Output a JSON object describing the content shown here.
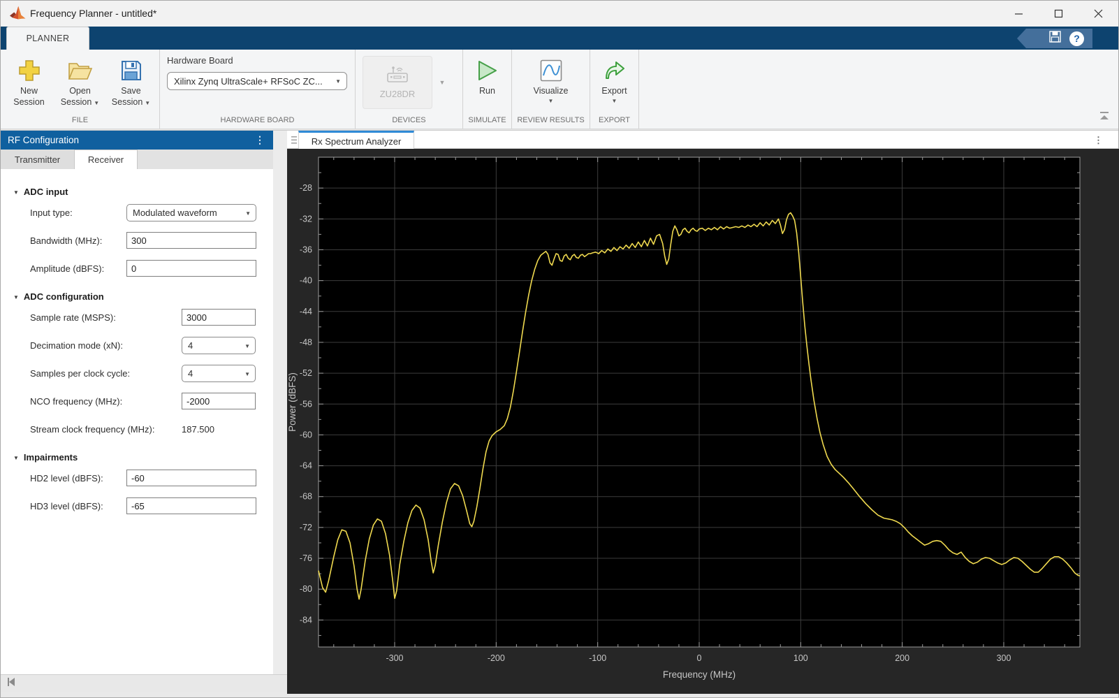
{
  "window": {
    "title": "Frequency Planner - untitled*"
  },
  "ribbon": {
    "tab_label": "PLANNER",
    "file": {
      "section_label": "FILE",
      "new_label": "New Session",
      "open_label": "Open Session",
      "save_label": "Save Session"
    },
    "hardware_board": {
      "section_label": "HARDWARE BOARD",
      "field_label": "Hardware Board",
      "value": "Xilinx Zynq UltraScale+ RFSoC ZC..."
    },
    "devices": {
      "section_label": "DEVICES",
      "device_label": "ZU28DR"
    },
    "simulate": {
      "section_label": "SIMULATE",
      "run_label": "Run"
    },
    "review": {
      "section_label": "REVIEW RESULTS",
      "visualize_label": "Visualize"
    },
    "export": {
      "section_label": "EXPORT",
      "export_label": "Export"
    }
  },
  "left_panel": {
    "header_title": "RF Configuration",
    "tabs": [
      {
        "label": "Transmitter"
      },
      {
        "label": "Receiver"
      }
    ],
    "adc_input": {
      "title": "ADC input",
      "input_type_label": "Input type:",
      "input_type_value": "Modulated waveform",
      "bandwidth_label": "Bandwidth (MHz):",
      "bandwidth_value": "300",
      "amplitude_label": "Amplitude (dBFS):",
      "amplitude_value": "0"
    },
    "adc_config": {
      "title": "ADC configuration",
      "sample_rate_label": "Sample rate (MSPS):",
      "sample_rate_value": "3000",
      "decimation_label": "Decimation mode (xN):",
      "decimation_value": "4",
      "spcc_label": "Samples per clock cycle:",
      "spcc_value": "4",
      "nco_label": "NCO frequency (MHz):",
      "nco_value": "-2000",
      "stream_clock_label": "Stream clock frequency (MHz):",
      "stream_clock_value": "187.500"
    },
    "impairments": {
      "title": "Impairments",
      "hd2_label": "HD2 level (dBFS):",
      "hd2_value": "-60",
      "hd3_label": "HD3 level (dBFS):",
      "hd3_value": "-65"
    }
  },
  "doc": {
    "tab_label": "Rx Spectrum Analyzer"
  },
  "chart_data": {
    "type": "line",
    "title": "Rx Spectrum Analyzer",
    "xlabel": "Frequency (MHz)",
    "ylabel": "Power (dBFS)",
    "xlim": [
      -375,
      375
    ],
    "ylim": [
      -87.5,
      -24
    ],
    "xticks": [
      -300,
      -200,
      -100,
      0,
      100,
      200,
      300
    ],
    "yticks": [
      -84,
      -80,
      -76,
      -72,
      -68,
      -64,
      -60,
      -56,
      -52,
      -48,
      -44,
      -40,
      -36,
      -32,
      -28
    ],
    "x_minor_step": 20,
    "y_minor_step": 2,
    "grid": true,
    "legend": "none",
    "colors": {
      "trace": "#EFD94F",
      "plot_bg": "#000000",
      "outer_bg": "#262626",
      "grid": "#3c3c3c",
      "axis": "#9c9c9c",
      "tick_text": "#c6c6c6"
    },
    "series": [
      {
        "name": "Rx spectrum",
        "points": [
          [
            -375,
            -77.6
          ],
          [
            -371,
            -79.8
          ],
          [
            -368,
            -80.4
          ],
          [
            -365,
            -78.9
          ],
          [
            -360,
            -75.8
          ],
          [
            -356,
            -73.6
          ],
          [
            -352,
            -72.3
          ],
          [
            -348,
            -72.5
          ],
          [
            -344,
            -74.0
          ],
          [
            -340,
            -77.0
          ],
          [
            -337,
            -80.0
          ],
          [
            -335,
            -81.3
          ],
          [
            -333,
            -80.0
          ],
          [
            -329,
            -76.3
          ],
          [
            -325,
            -73.5
          ],
          [
            -321,
            -71.7
          ],
          [
            -317,
            -70.9
          ],
          [
            -313,
            -71.2
          ],
          [
            -309,
            -72.8
          ],
          [
            -305,
            -75.6
          ],
          [
            -302,
            -78.8
          ],
          [
            -300,
            -81.2
          ],
          [
            -298,
            -80.2
          ],
          [
            -295,
            -76.8
          ],
          [
            -291,
            -73.8
          ],
          [
            -287,
            -71.4
          ],
          [
            -283,
            -69.8
          ],
          [
            -279,
            -69.1
          ],
          [
            -275,
            -69.5
          ],
          [
            -271,
            -71.0
          ],
          [
            -267,
            -73.6
          ],
          [
            -264,
            -76.4
          ],
          [
            -262,
            -77.9
          ],
          [
            -260,
            -76.9
          ],
          [
            -257,
            -74.3
          ],
          [
            -253,
            -71.3
          ],
          [
            -249,
            -68.8
          ],
          [
            -245,
            -67.0
          ],
          [
            -241,
            -66.3
          ],
          [
            -237,
            -66.6
          ],
          [
            -233,
            -67.9
          ],
          [
            -229,
            -69.9
          ],
          [
            -226,
            -71.5
          ],
          [
            -224,
            -71.9
          ],
          [
            -222,
            -71.2
          ],
          [
            -219,
            -69.3
          ],
          [
            -216,
            -66.9
          ],
          [
            -213,
            -64.4
          ],
          [
            -210,
            -62.2
          ],
          [
            -207,
            -60.8
          ],
          [
            -204,
            -60.1
          ],
          [
            -200,
            -59.6
          ],
          [
            -196,
            -59.3
          ],
          [
            -192,
            -58.8
          ],
          [
            -189,
            -57.9
          ],
          [
            -186,
            -56.4
          ],
          [
            -183,
            -54.3
          ],
          [
            -180,
            -51.8
          ],
          [
            -177,
            -49.2
          ],
          [
            -174,
            -46.6
          ],
          [
            -171,
            -44.1
          ],
          [
            -168,
            -41.9
          ],
          [
            -165,
            -40.0
          ],
          [
            -162,
            -38.5
          ],
          [
            -159,
            -37.4
          ],
          [
            -156,
            -36.7
          ],
          [
            -153,
            -36.4
          ],
          [
            -151,
            -36.2
          ],
          [
            -149,
            -36.6
          ],
          [
            -147,
            -37.7
          ],
          [
            -145,
            -38.0
          ],
          [
            -143,
            -37.2
          ],
          [
            -141,
            -36.5
          ],
          [
            -139,
            -36.6
          ],
          [
            -137,
            -37.4
          ],
          [
            -135,
            -37.5
          ],
          [
            -133,
            -36.8
          ],
          [
            -131,
            -36.6
          ],
          [
            -129,
            -37.1
          ],
          [
            -127,
            -37.3
          ],
          [
            -125,
            -36.8
          ],
          [
            -123,
            -36.6
          ],
          [
            -121,
            -37.0
          ],
          [
            -119,
            -37.1
          ],
          [
            -117,
            -36.7
          ],
          [
            -115,
            -36.6
          ],
          [
            -113,
            -36.9
          ],
          [
            -111,
            -36.7
          ],
          [
            -109,
            -36.5
          ],
          [
            -107,
            -36.5
          ],
          [
            -105,
            -36.4
          ],
          [
            -102,
            -36.3
          ],
          [
            -99,
            -36.5
          ],
          [
            -96,
            -36.1
          ],
          [
            -93,
            -36.4
          ],
          [
            -90,
            -35.9
          ],
          [
            -87,
            -36.2
          ],
          [
            -84,
            -35.7
          ],
          [
            -81,
            -36.1
          ],
          [
            -78,
            -35.6
          ],
          [
            -75,
            -35.9
          ],
          [
            -72,
            -35.4
          ],
          [
            -69,
            -35.8
          ],
          [
            -66,
            -35.2
          ],
          [
            -63,
            -35.7
          ],
          [
            -60,
            -35.0
          ],
          [
            -57,
            -35.6
          ],
          [
            -54,
            -34.8
          ],
          [
            -51,
            -35.5
          ],
          [
            -48,
            -34.5
          ],
          [
            -45,
            -35.3
          ],
          [
            -42,
            -34.2
          ],
          [
            -39,
            -34.0
          ],
          [
            -36,
            -35.2
          ],
          [
            -34,
            -36.8
          ],
          [
            -32,
            -37.9
          ],
          [
            -30,
            -37.2
          ],
          [
            -28,
            -35.3
          ],
          [
            -26,
            -33.6
          ],
          [
            -24,
            -32.9
          ],
          [
            -22,
            -33.4
          ],
          [
            -20,
            -34.2
          ],
          [
            -18,
            -34.0
          ],
          [
            -16,
            -33.4
          ],
          [
            -14,
            -33.2
          ],
          [
            -12,
            -33.6
          ],
          [
            -10,
            -33.8
          ],
          [
            -8,
            -33.4
          ],
          [
            -6,
            -33.2
          ],
          [
            -4,
            -33.5
          ],
          [
            -2,
            -33.6
          ],
          [
            0,
            -33.3
          ],
          [
            3,
            -33.2
          ],
          [
            6,
            -33.5
          ],
          [
            9,
            -33.2
          ],
          [
            12,
            -33.4
          ],
          [
            15,
            -33.1
          ],
          [
            18,
            -33.4
          ],
          [
            21,
            -33.0
          ],
          [
            24,
            -33.3
          ],
          [
            27,
            -33.0
          ],
          [
            30,
            -33.2
          ],
          [
            33,
            -33.1
          ],
          [
            36,
            -33.0
          ],
          [
            39,
            -33.1
          ],
          [
            42,
            -32.9
          ],
          [
            45,
            -33.1
          ],
          [
            48,
            -32.8
          ],
          [
            51,
            -33.0
          ],
          [
            54,
            -32.7
          ],
          [
            57,
            -33.0
          ],
          [
            60,
            -32.5
          ],
          [
            63,
            -32.9
          ],
          [
            66,
            -32.4
          ],
          [
            69,
            -32.8
          ],
          [
            72,
            -32.2
          ],
          [
            75,
            -32.6
          ],
          [
            78,
            -32.0
          ],
          [
            80,
            -32.8
          ],
          [
            82,
            -33.9
          ],
          [
            84,
            -33.4
          ],
          [
            86,
            -32.1
          ],
          [
            88,
            -31.4
          ],
          [
            90,
            -31.2
          ],
          [
            92,
            -31.6
          ],
          [
            94,
            -32.2
          ],
          [
            96,
            -33.8
          ],
          [
            98,
            -36.3
          ],
          [
            100,
            -39.5
          ],
          [
            102,
            -42.8
          ],
          [
            104,
            -45.8
          ],
          [
            106,
            -48.4
          ],
          [
            108,
            -50.7
          ],
          [
            110,
            -52.8
          ],
          [
            113,
            -55.5
          ],
          [
            116,
            -57.8
          ],
          [
            119,
            -59.7
          ],
          [
            122,
            -61.2
          ],
          [
            126,
            -62.8
          ],
          [
            130,
            -63.8
          ],
          [
            134,
            -64.5
          ],
          [
            138,
            -65.0
          ],
          [
            142,
            -65.5
          ],
          [
            147,
            -66.2
          ],
          [
            152,
            -67.0
          ],
          [
            158,
            -68.0
          ],
          [
            164,
            -68.9
          ],
          [
            170,
            -69.7
          ],
          [
            176,
            -70.4
          ],
          [
            182,
            -70.8
          ],
          [
            186,
            -70.9
          ],
          [
            190,
            -71.0
          ],
          [
            194,
            -71.2
          ],
          [
            198,
            -71.5
          ],
          [
            202,
            -72.0
          ],
          [
            206,
            -72.6
          ],
          [
            210,
            -73.1
          ],
          [
            214,
            -73.5
          ],
          [
            218,
            -73.9
          ],
          [
            222,
            -74.3
          ],
          [
            226,
            -74.1
          ],
          [
            230,
            -73.8
          ],
          [
            234,
            -73.7
          ],
          [
            238,
            -73.8
          ],
          [
            242,
            -74.3
          ],
          [
            246,
            -74.9
          ],
          [
            250,
            -75.3
          ],
          [
            254,
            -75.5
          ],
          [
            258,
            -75.2
          ],
          [
            262,
            -75.9
          ],
          [
            266,
            -76.4
          ],
          [
            270,
            -76.7
          ],
          [
            274,
            -76.5
          ],
          [
            278,
            -76.1
          ],
          [
            282,
            -75.9
          ],
          [
            286,
            -76.0
          ],
          [
            290,
            -76.3
          ],
          [
            294,
            -76.6
          ],
          [
            298,
            -76.8
          ],
          [
            302,
            -76.6
          ],
          [
            306,
            -76.2
          ],
          [
            310,
            -75.9
          ],
          [
            314,
            -76.0
          ],
          [
            318,
            -76.4
          ],
          [
            322,
            -76.9
          ],
          [
            326,
            -77.4
          ],
          [
            330,
            -77.8
          ],
          [
            334,
            -77.8
          ],
          [
            338,
            -77.3
          ],
          [
            342,
            -76.7
          ],
          [
            346,
            -76.1
          ],
          [
            350,
            -75.8
          ],
          [
            354,
            -75.8
          ],
          [
            358,
            -76.1
          ],
          [
            362,
            -76.6
          ],
          [
            366,
            -77.2
          ],
          [
            370,
            -77.9
          ],
          [
            373,
            -78.2
          ],
          [
            375,
            -78.3
          ]
        ]
      }
    ]
  }
}
